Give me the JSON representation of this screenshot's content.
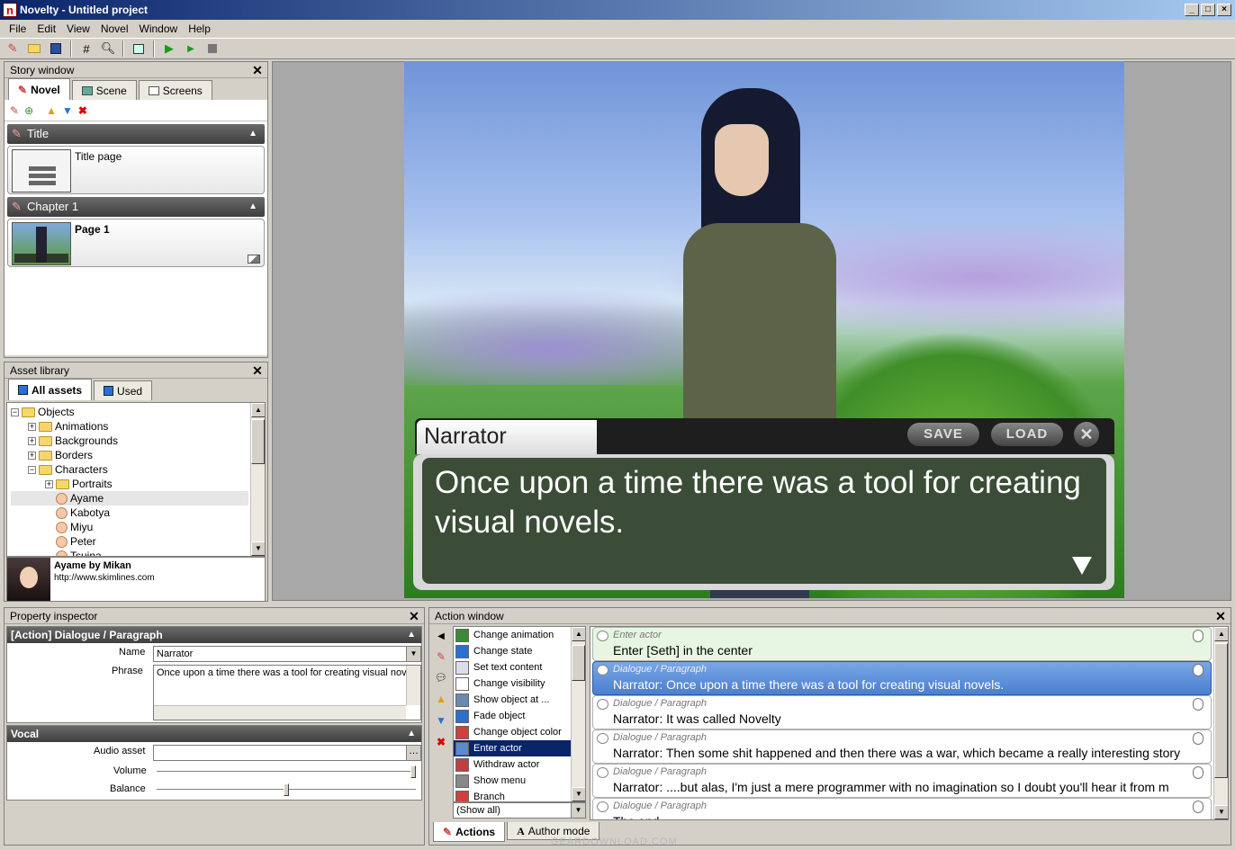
{
  "window": {
    "title": "Novelty - Untitled project",
    "icon": "n"
  },
  "menu": [
    "File",
    "Edit",
    "View",
    "Novel",
    "Window",
    "Help"
  ],
  "story_window": {
    "title": "Story window",
    "tabs": [
      "Novel",
      "Scene",
      "Screens"
    ],
    "groups": [
      {
        "name": "Title",
        "page": "Title page"
      },
      {
        "name": "Chapter 1",
        "page": "Page 1"
      }
    ]
  },
  "asset_library": {
    "title": "Asset library",
    "tabs": [
      "All assets",
      "Used"
    ],
    "tree": [
      {
        "label": "Objects",
        "indent": 0,
        "kind": "folder",
        "pm": "−"
      },
      {
        "label": "Animations",
        "indent": 1,
        "kind": "folder",
        "pm": "+"
      },
      {
        "label": "Backgrounds",
        "indent": 1,
        "kind": "folder",
        "pm": "+"
      },
      {
        "label": "Borders",
        "indent": 1,
        "kind": "folder",
        "pm": "+"
      },
      {
        "label": "Characters",
        "indent": 1,
        "kind": "folder",
        "pm": "−"
      },
      {
        "label": "Portraits",
        "indent": 2,
        "kind": "folder",
        "pm": "+"
      },
      {
        "label": "Ayame",
        "indent": 2,
        "kind": "char",
        "pm": ""
      },
      {
        "label": "Kabotya",
        "indent": 2,
        "kind": "char",
        "pm": ""
      },
      {
        "label": "Miyu",
        "indent": 2,
        "kind": "char",
        "pm": ""
      },
      {
        "label": "Peter",
        "indent": 2,
        "kind": "char",
        "pm": ""
      },
      {
        "label": "Tsujna",
        "indent": 2,
        "kind": "char",
        "pm": ""
      }
    ],
    "preview_name": "Ayame by Mikan",
    "preview_url": "http://www.skimlines.com"
  },
  "stage": {
    "speaker": "Narrator",
    "save": "SAVE",
    "load": "LOAD",
    "text": "Once upon a time there was a tool for creating visual novels."
  },
  "property_inspector": {
    "title": "Property inspector",
    "section1": "[Action] Dialogue / Paragraph",
    "name_label": "Name",
    "name_value": "Narrator",
    "phrase_label": "Phrase",
    "phrase_value": "Once upon a time there was a tool for creating visual novels.",
    "section2": "Vocal",
    "audio_label": "Audio asset",
    "volume_label": "Volume",
    "balance_label": "Balance",
    "volume": 1.0,
    "balance": 0.5
  },
  "action_window": {
    "title": "Action window",
    "actions": [
      "Change animation",
      "Change state",
      "Set text content",
      "Change visibility",
      "Show object at ...",
      "Fade object",
      "Change object color",
      "Enter actor",
      "Withdraw actor",
      "Show menu",
      "Branch"
    ],
    "filter": "(Show all)",
    "entries": [
      {
        "type": "Enter actor",
        "text": "Enter [Seth] in the center"
      },
      {
        "type": "Dialogue / Paragraph",
        "text": "Narrator: Once upon a time there was a tool for creating visual novels."
      },
      {
        "type": "Dialogue / Paragraph",
        "text": "Narrator: It was called Novelty"
      },
      {
        "type": "Dialogue / Paragraph",
        "text": "Narrator: Then some shit happened and then there was a war, which became a really interesting story"
      },
      {
        "type": "Dialogue / Paragraph",
        "text": "Narrator: ....but alas, I'm just a mere programmer with no imagination so I doubt you'll hear it from m"
      },
      {
        "type": "Dialogue / Paragraph",
        "text": "The end"
      }
    ],
    "bottom_tabs": [
      "Actions",
      "Author mode"
    ]
  },
  "watermark": "GEARDOWNLOAD.COM"
}
